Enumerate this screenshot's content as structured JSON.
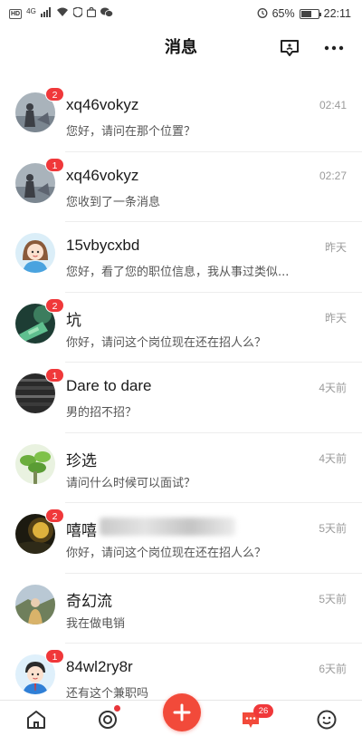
{
  "status_bar": {
    "hd_label": "HD",
    "network": "4G",
    "battery_percent": "65%",
    "battery_level": 0.65,
    "time": "22:11"
  },
  "header": {
    "title": "消息",
    "contacts_icon": "contacts-icon",
    "more_icon": "more-icon"
  },
  "messages": [
    {
      "name": "xq46vokyz",
      "preview": "您好，请问在那个位置？",
      "time": "02:41",
      "badge": "2",
      "avatar": "photo-silhouette"
    },
    {
      "name": "xq46vokyz",
      "preview": "您收到了一条消息",
      "time": "02:27",
      "badge": "1",
      "avatar": "photo-silhouette"
    },
    {
      "name": "15vbycxbd",
      "preview": "您好，看了您的职位信息，我从事过类似...",
      "time": "昨天",
      "badge": "",
      "avatar": "cartoon-girl"
    },
    {
      "name": "坑",
      "preview": "你好，请问这个岗位现在还在招人么？",
      "time": "昨天",
      "badge": "2",
      "avatar": "photo-green"
    },
    {
      "name": "Dare to dare",
      "preview": "男的招不招？",
      "time": "4天前",
      "badge": "1",
      "avatar": "photo-dark"
    },
    {
      "name": "珍选",
      "preview": "请问什么时候可以面试？",
      "time": "4天前",
      "badge": "",
      "avatar": "photo-plant"
    },
    {
      "name": "嘻嘻",
      "preview": "你好，请问这个岗位现在还在招人么？",
      "time": "5天前",
      "badge": "2",
      "avatar": "photo-sunset"
    },
    {
      "name": "奇幻流",
      "preview": "我在做电销",
      "time": "5天前",
      "badge": "",
      "avatar": "photo-person"
    },
    {
      "name": "84wl2ry8r",
      "preview": "还有这个兼职吗",
      "time": "6天前",
      "badge": "1",
      "avatar": "cartoon-boy"
    }
  ],
  "tabbar": {
    "home_icon": "home-icon",
    "discover_icon": "discover-icon",
    "post_icon": "plus-icon",
    "messages_icon": "messages-icon",
    "messages_badge": "26",
    "me_icon": "smiley-icon"
  },
  "colors": {
    "accent": "#f24a3a",
    "badge": "#f0383a"
  }
}
